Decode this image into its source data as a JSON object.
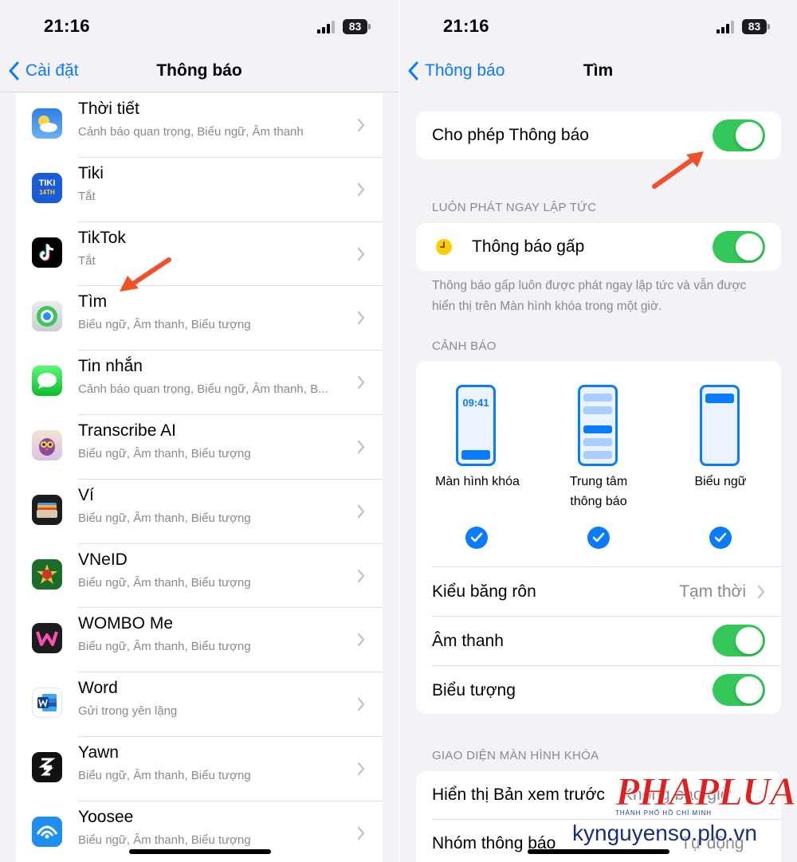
{
  "status": {
    "time": "21:16",
    "battery": "83"
  },
  "left": {
    "back_label": "Cài đặt",
    "title": "Thông báo",
    "apps": [
      {
        "name": "Thời tiết",
        "sub": "Cảnh báo quan trọng, Biểu ngữ, Âm thanh",
        "icon": "weather-icon"
      },
      {
        "name": "Tiki",
        "sub": "Tắt",
        "icon": "tiki-icon"
      },
      {
        "name": "TikTok",
        "sub": "Tắt",
        "icon": "tiktok-icon"
      },
      {
        "name": "Tìm",
        "sub": "Biểu ngữ, Âm thanh, Biểu tượng",
        "icon": "find-my-icon"
      },
      {
        "name": "Tin nhắn",
        "sub": "Cảnh báo quan trọng, Biểu ngữ, Âm thanh, B...",
        "icon": "messages-icon"
      },
      {
        "name": "Transcribe AI",
        "sub": "Biểu ngữ, Âm thanh, Biểu tượng",
        "icon": "transcribe-ai-icon"
      },
      {
        "name": "Ví",
        "sub": "Biểu ngữ, Âm thanh, Biểu tượng",
        "icon": "wallet-icon"
      },
      {
        "name": "VNeID",
        "sub": "Biểu ngữ, Âm thanh, Biểu tượng",
        "icon": "vneid-icon"
      },
      {
        "name": "WOMBO Me",
        "sub": "Biểu ngữ, Âm thanh, Biểu tượng",
        "icon": "wombo-me-icon"
      },
      {
        "name": "Word",
        "sub": "Gửi trong yên lặng",
        "icon": "word-icon"
      },
      {
        "name": "Yawn",
        "sub": "Biểu ngữ, Âm thanh, Biểu tượng",
        "icon": "yawn-icon"
      },
      {
        "name": "Yoosee",
        "sub": "Biểu ngữ, Âm thanh, Biểu tượng",
        "icon": "yoosee-icon"
      }
    ],
    "icon_labels": {
      "tiki": "TIKI",
      "tiki_sub": "14TH"
    }
  },
  "right": {
    "back_label": "Thông báo",
    "title": "Tìm",
    "allow_label": "Cho phép Thông báo",
    "allow_on": true,
    "section_immediate": "LUÔN PHÁT NGAY LẬP TỨC",
    "urgent_label": "Thông báo gấp",
    "urgent_on": true,
    "urgent_note": "Thông báo gấp luôn được phát ngay lập tức và vẫn được hiển thị trên Màn hình khóa trong một giờ.",
    "section_alerts": "CẢNH BÁO",
    "alert_types": [
      {
        "label": "Màn hình khóa",
        "checked": true,
        "preview_time": "09:41"
      },
      {
        "label_line1": "Trung tâm",
        "label_line2": "thông báo",
        "checked": true
      },
      {
        "label": "Biểu ngữ",
        "checked": true
      }
    ],
    "banner_style_label": "Kiểu băng rôn",
    "banner_style_value": "Tạm thời",
    "sound_label": "Âm thanh",
    "sound_on": true,
    "badge_label": "Biểu tượng",
    "badge_on": true,
    "section_lock": "GIAO DIỆN MÀN HÌNH KHÓA",
    "preview_label": "Hiển thị Bản xem trước",
    "preview_value": "Không bao giờ",
    "grouping_label": "Nhóm thông báo",
    "grouping_value": "Tự động"
  },
  "watermark": {
    "brand": "PHAPLUAT",
    "tagline": "THÀNH PHỐ HỒ CHÍ MINH",
    "site": "kynguyenso.plo.vn"
  },
  "colors": {
    "accent": "#0a7aff",
    "toggle_on": "#34c759",
    "arrow": "#f0502a"
  }
}
